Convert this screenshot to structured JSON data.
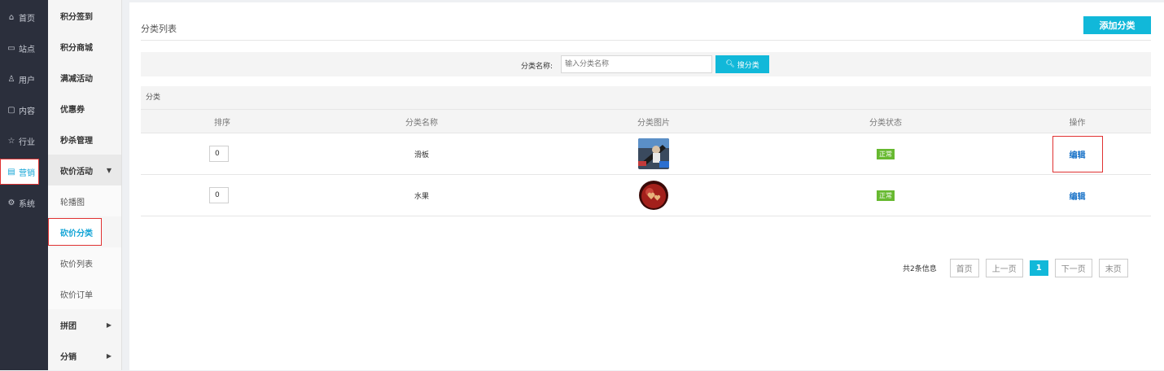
{
  "primary_nav": [
    {
      "icon": "home-icon",
      "glyph": "⌂",
      "label": "首页"
    },
    {
      "icon": "monitor-icon",
      "glyph": "▭",
      "label": "站点"
    },
    {
      "icon": "user-icon",
      "glyph": "♙",
      "label": "用户"
    },
    {
      "icon": "content-icon",
      "glyph": "▢",
      "label": "内容"
    },
    {
      "icon": "star-icon",
      "glyph": "☆",
      "label": "行业"
    },
    {
      "icon": "marketing-icon",
      "glyph": "▤",
      "label": "营销"
    },
    {
      "icon": "settings-icon",
      "glyph": "⚙",
      "label": "系统"
    }
  ],
  "secondary_nav": [
    {
      "label": "积分签到"
    },
    {
      "label": "积分商城"
    },
    {
      "label": "满减活动"
    },
    {
      "label": "优惠券"
    },
    {
      "label": "秒杀管理"
    },
    {
      "label": "砍价活动"
    },
    {
      "label": "轮播图"
    },
    {
      "label": "砍价分类"
    },
    {
      "label": "砍价列表"
    },
    {
      "label": "砍价订单"
    },
    {
      "label": "拼团"
    },
    {
      "label": "分销"
    }
  ],
  "page": {
    "title": "分类列表",
    "add_button": "添加分类"
  },
  "search": {
    "label": "分类名称:",
    "placeholder": "输入分类名称",
    "button": "搜分类"
  },
  "table": {
    "caption": "分类",
    "headers": [
      "排序",
      "分类名称",
      "分类图片",
      "分类状态",
      "操作"
    ],
    "rows": [
      {
        "sort": "0",
        "name": "滑板",
        "image": "skateboard-thumbnail",
        "status": "正常",
        "action": "编辑"
      },
      {
        "sort": "0",
        "name": "水果",
        "image": "apple-thumbnail",
        "status": "正常",
        "action": "编辑"
      }
    ]
  },
  "pagination": {
    "summary": "共2条信息",
    "first": "首页",
    "prev": "上一页",
    "current": "1",
    "next": "下一页",
    "last": "末页"
  },
  "colors": {
    "accent": "#11b8d9",
    "status_green": "#67b930",
    "link_blue": "#1a73c8",
    "highlight_red": "#e03232",
    "sidebar_dark": "#2b2f3c"
  }
}
